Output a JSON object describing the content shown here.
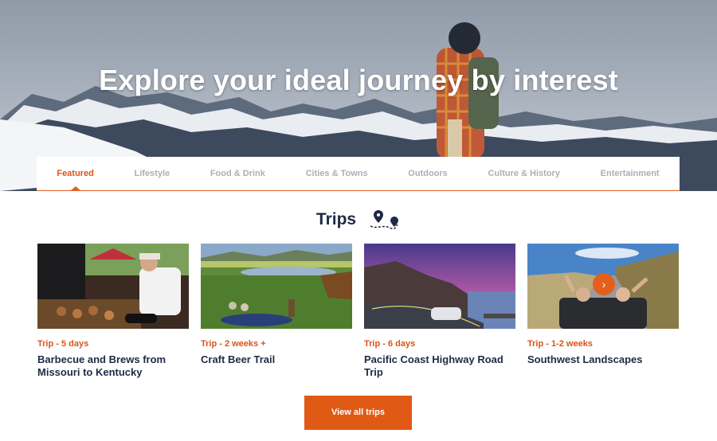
{
  "hero": {
    "title": "Explore your ideal journey by interest"
  },
  "tabs": [
    {
      "label": "Featured",
      "active": true
    },
    {
      "label": "Lifestyle",
      "active": false
    },
    {
      "label": "Food & Drink",
      "active": false
    },
    {
      "label": "Cities & Towns",
      "active": false
    },
    {
      "label": "Outdoors",
      "active": false
    },
    {
      "label": "Culture & History",
      "active": false
    },
    {
      "label": "Entertainment",
      "active": false
    }
  ],
  "section": {
    "title": "Trips",
    "icon": "route-pins-icon"
  },
  "cards": [
    {
      "meta": "Trip - 5 days",
      "name": "Barbecue and Brews from Missouri to Kentucky"
    },
    {
      "meta": "Trip - 2 weeks +",
      "name": "Craft Beer Trail"
    },
    {
      "meta": "Trip - 6 days",
      "name": "Pacific Coast Highway Road Trip"
    },
    {
      "meta": "Trip - 1-2 weeks",
      "name": "Southwest Landscapes"
    }
  ],
  "carousel": {
    "next_icon": "chevron-right-icon",
    "next_glyph": "›"
  },
  "cta": {
    "label": "View all trips"
  },
  "colors": {
    "accent": "#e05a16",
    "heading": "#1f2a44",
    "tab_inactive": "#aab0b8"
  }
}
